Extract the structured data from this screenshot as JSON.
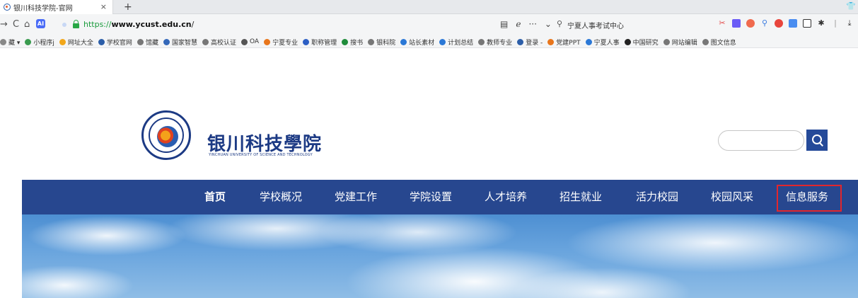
{
  "browser": {
    "tab_title": "银川科技学院-官网",
    "new_tab_label": "+",
    "close_label": "×",
    "nav": {
      "back": "→",
      "reload": "C",
      "home": "⌂",
      "ai_badge": "AI"
    },
    "url_scheme": "https://",
    "url_host": "www.ycust.edu.cn",
    "url_path": "/",
    "search_text": "宁夏人事考试中心",
    "url_icons": [
      "▤",
      "ℯ",
      "···",
      "⌄"
    ],
    "bookmarks": [
      {
        "label": "藏 ▾",
        "color": "#888888"
      },
      {
        "label": "小程序j",
        "color": "#3a9b4f"
      },
      {
        "label": "网址大全",
        "color": "#f2a71b"
      },
      {
        "label": "学校官网",
        "color": "#2c5ea8"
      },
      {
        "label": "馆藏",
        "color": "#777777"
      },
      {
        "label": "国家智慧",
        "color": "#3568b9"
      },
      {
        "label": "高校认证",
        "color": "#777777"
      },
      {
        "label": "OA",
        "color": "#555555"
      },
      {
        "label": "宁夏专业",
        "color": "#e8761c"
      },
      {
        "label": "职称管理",
        "color": "#2d5fc4"
      },
      {
        "label": "搜书",
        "color": "#1f8c3b"
      },
      {
        "label": "银科院",
        "color": "#777777"
      },
      {
        "label": "站长素材",
        "color": "#2b78d6"
      },
      {
        "label": "计划总结",
        "color": "#2b78d6"
      },
      {
        "label": "教师专业",
        "color": "#777777"
      },
      {
        "label": "登录 -",
        "color": "#2c5ea8"
      },
      {
        "label": "党建PPT",
        "color": "#e8761c"
      },
      {
        "label": "宁夏人事",
        "color": "#2b78d6"
      },
      {
        "label": "中国研究",
        "color": "#222222"
      },
      {
        "label": "网站编辑",
        "color": "#777777"
      },
      {
        "label": "图文信息",
        "color": "#777777"
      }
    ]
  },
  "site": {
    "name": "银川科技學院",
    "name_en": "YINCHUAN UNIVERSITY OF SCIENCE AND TECHNOLOGY",
    "search_placeholder": "",
    "nav": [
      "首页",
      "学校概况",
      "党建工作",
      "学院设置",
      "人才培养",
      "招生就业",
      "活力校园",
      "校园风采",
      "信息服务"
    ],
    "highlighted_nav": "信息服务",
    "highlight_color": "#e3262c",
    "nav_bg": "#27478f",
    "brand_color": "#1c3a84"
  }
}
